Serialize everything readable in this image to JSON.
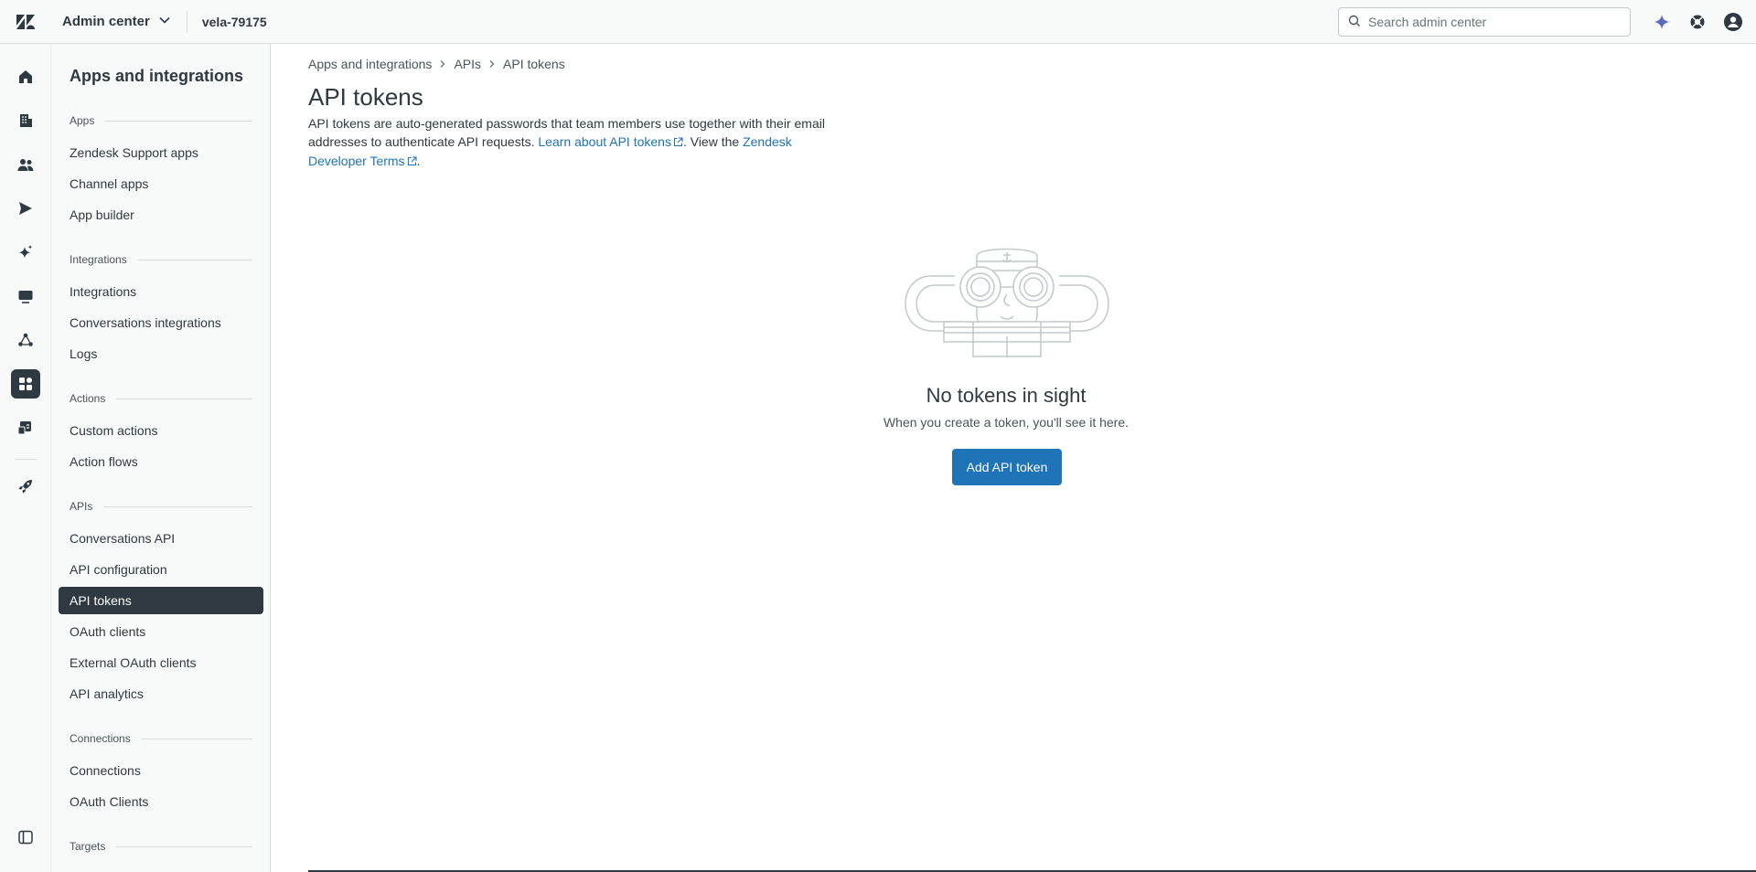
{
  "topbar": {
    "product": "Admin center",
    "account": "vela-79175",
    "search_placeholder": "Search admin center"
  },
  "rail": {
    "items": [
      "home-icon",
      "building-icon",
      "people-icon",
      "send-icon",
      "sparkle-icon",
      "monitor-icon",
      "objects-icon",
      "apps-grid-icon",
      "account-icon",
      "rocket-icon"
    ],
    "active": "apps-grid-icon"
  },
  "subnav": {
    "title": "Apps and integrations",
    "sections": [
      {
        "label": "Apps",
        "items": [
          "Zendesk Support apps",
          "Channel apps",
          "App builder"
        ]
      },
      {
        "label": "Integrations",
        "items": [
          "Integrations",
          "Conversations integrations",
          "Logs"
        ]
      },
      {
        "label": "Actions",
        "items": [
          "Custom actions",
          "Action flows"
        ]
      },
      {
        "label": "APIs",
        "items": [
          "Conversations API",
          "API configuration",
          "API tokens",
          "OAuth clients",
          "External OAuth clients",
          "API analytics"
        ]
      },
      {
        "label": "Connections",
        "items": [
          "Connections",
          "OAuth Clients"
        ]
      },
      {
        "label": "Targets",
        "items": []
      }
    ],
    "active_item": "API tokens"
  },
  "main": {
    "breadcrumb": [
      "Apps and integrations",
      "APIs",
      "API tokens"
    ],
    "title": "API tokens",
    "description_text": "API tokens are auto-generated passwords that team members use together with their email addresses to authenticate API requests.",
    "link_learn": "Learn about API tokens",
    "view_the": ". View the",
    "link_terms": "Zendesk Developer Terms",
    "period": ".",
    "empty_title": "No tokens in sight",
    "empty_subtitle": "When you create a token, you'll see it here.",
    "add_button": "Add API token"
  },
  "colors": {
    "accent": "#1f73b7",
    "dark": "#2f3941",
    "sparkle": "#5c6ac4"
  }
}
